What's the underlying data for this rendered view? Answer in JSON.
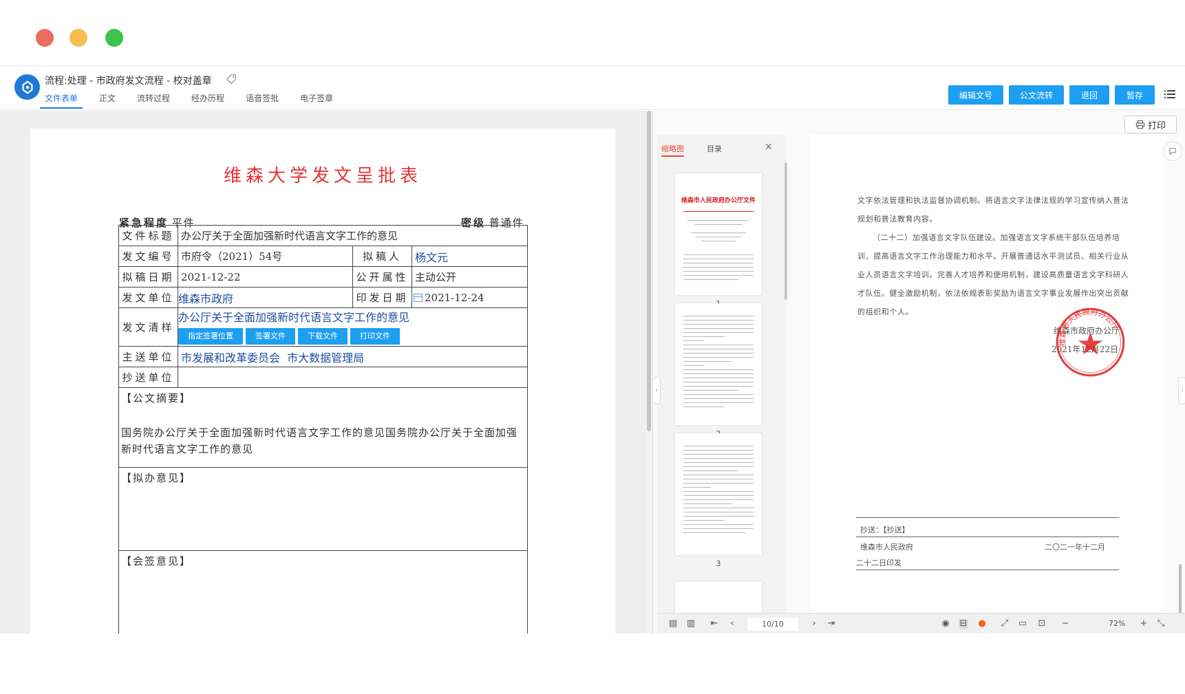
{
  "header": {
    "flow_title": "流程:处理 - 市政府发文流程 - 校对盖章",
    "tabs": [
      "文件表单",
      "正文",
      "流转过程",
      "经办历程",
      "语音签批",
      "电子签章"
    ],
    "active_tab": "文件表单",
    "buttons": [
      "编辑文号",
      "公文流转",
      "退回",
      "暂存"
    ],
    "accent": "#1d9ff1"
  },
  "form": {
    "title": "维森大学发文呈批表",
    "urgency_label": "紧急程度",
    "urgency_value": "平件",
    "secret_label": "密级",
    "secret_value": "普通件",
    "rows": {
      "doc_title_label": "文件标题",
      "doc_title_value": "办公厅关于全面加强新时代语言文字工作的意见",
      "doc_no_label": "发文编号",
      "doc_no_value": "市府令（2021）54号",
      "drafter_label": "拟稿人",
      "drafter_value": "杨文元",
      "draft_date_label": "拟稿日期",
      "draft_date_value": "2021-12-22",
      "public_label": "公开属性",
      "public_value": "主动公开",
      "unit_label": "发文单位",
      "unit_value": "维森市政府",
      "print_date_label": "印发日期",
      "print_date_value": "2021-12-24",
      "clean_label": "发文清样",
      "clean_value": "办公厅关于全面加强新时代语言文字工作的意见",
      "clean_buttons": [
        "指定签署位置",
        "签署文件",
        "下载文件",
        "打印文件"
      ],
      "main_send_label": "主送单位",
      "main_send_value": "市发展和改革委员会  市大数据管理局",
      "cc_label": "抄送单位",
      "cc_value": ""
    },
    "summary_heading": "【公文摘要】",
    "summary_text": "国务院办公厅关于全面加强新时代语言文字工作的意见国务院办公厅关于全面加强新时代语言文字工作的意见",
    "opinion_heading": "【拟办意见】",
    "countersign_heading": "【会签意见】"
  },
  "viewer": {
    "print_label": "打印",
    "thumb_tab": "缩略图",
    "toc_tab": "目录",
    "page_numbers": [
      "1",
      "2",
      "3"
    ],
    "thumb_red_title": "维森市人民政府办公厅文件",
    "page_indicator": "10/10",
    "zoom": "72%",
    "doc_paragraph1": "文字依法管理和执法监督协调机制。将语言文字法律法规的学习宣传纳入普法规划和普法教育内容。",
    "doc_paragraph2": "（二十二）加强语言文字队伍建设。加强语言文字系统干部队伍培养培训，提高语言文字工作治理能力和水平。开展普通话水平测试员、相关行业从业人员语言文字培训。完善人才培养和使用机制，建设高质量语言文字科研人才队伍。健全激励机制，依法依规表彰奖励为语言文字事业发展作出突出贡献的组织和个人。",
    "sign_org": "维森市政府办公厅",
    "sign_date": "2021年12月22日",
    "cc_line": "抄送：【抄送】",
    "issuer": "维森市人民政府",
    "issue_date_a": "二〇二一年十二月",
    "issue_date_b": "二十二日印发",
    "seal_text": "维森市人民政府办公厅"
  }
}
